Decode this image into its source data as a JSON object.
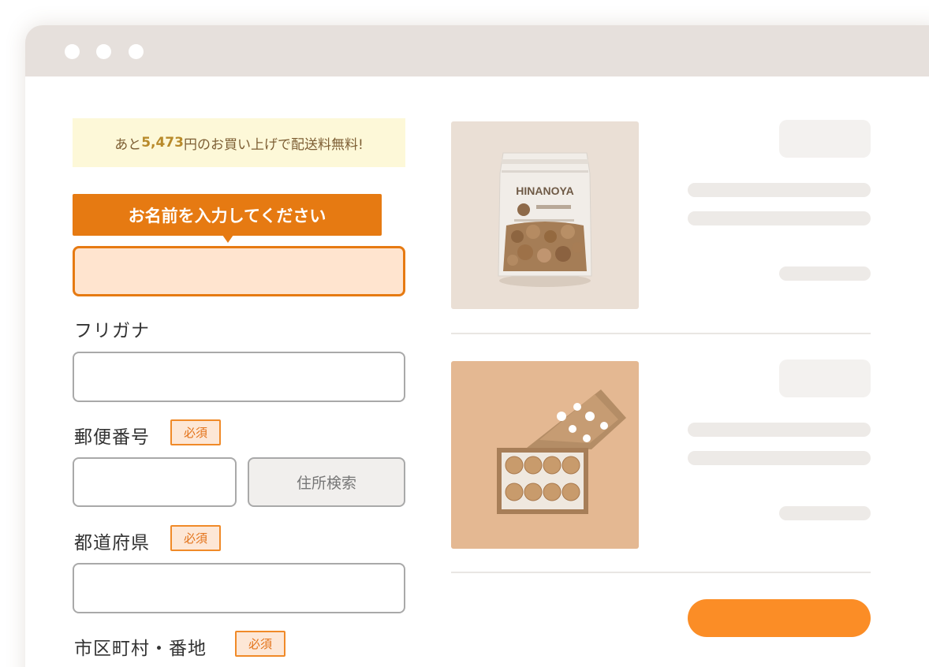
{
  "window": {
    "controls": [
      "close",
      "minimize",
      "maximize"
    ]
  },
  "banner": {
    "prefix": "あと",
    "amount": "5,473",
    "suffix": "円のお買い上げで配送料無料!"
  },
  "name_field": {
    "tooltip": "お名前を入力してください",
    "value": ""
  },
  "furigana": {
    "label": "フリガナ",
    "value": ""
  },
  "postal": {
    "label": "郵便番号",
    "required": "必須",
    "value": "",
    "search_label": "住所検索"
  },
  "prefecture": {
    "label": "都道府県",
    "required": "必須",
    "value": ""
  },
  "city": {
    "label": "市区町村・番地",
    "required": "必須"
  },
  "products": [
    {
      "image": "nut-snack-pouch-photo",
      "brand": "HINANOYA"
    },
    {
      "image": "cookie-gift-box-photo"
    }
  ],
  "colors": {
    "accent": "#e67a12",
    "cta": "#fb8d26",
    "banner_bg": "#fdf8d8",
    "active_input_bg": "#ffe4cf",
    "titlebar": "#e6e0dc"
  }
}
